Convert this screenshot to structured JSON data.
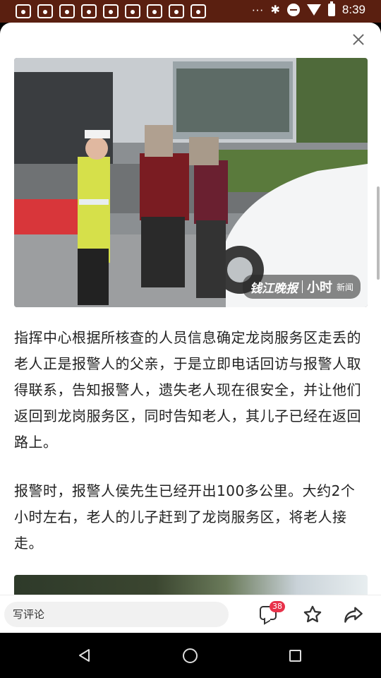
{
  "status_bar": {
    "time": "8:39",
    "more": "···",
    "icons": [
      "app-notification-icon",
      "app-notification-icon",
      "app-notification-icon",
      "app-notification-icon",
      "app-notification-icon",
      "app-notification-icon",
      "app-notification-icon",
      "app-notification-icon",
      "app-notification-icon",
      "bluetooth-icon",
      "do-not-disturb-icon",
      "wifi-icon",
      "battery-icon"
    ]
  },
  "article": {
    "photo_watermark": {
      "outlet": "钱江晚报",
      "brand": "小时",
      "suffix": "新闻"
    },
    "paragraphs": [
      "指挥中心根据所核查的人员信息确定龙岗服务区走丢的老人正是报警人的父亲，于是立即电话回访与报警人取得联系，告知报警人，遗失老人现在很安全，并让他们返回到龙岗服务区，同时告知老人，其儿子已经在返回路上。",
      "报警时，报警人侯先生已经开出100多公里。大约2个小时左右，老人的儿子赶到了龙岗服务区，将老人接走。"
    ]
  },
  "bottom_bar": {
    "comment_placeholder": "写评论",
    "comment_count": "38"
  },
  "colors": {
    "status_bar_bg": "#5a1f10",
    "badge": "#e8324a",
    "text": "#222222"
  }
}
